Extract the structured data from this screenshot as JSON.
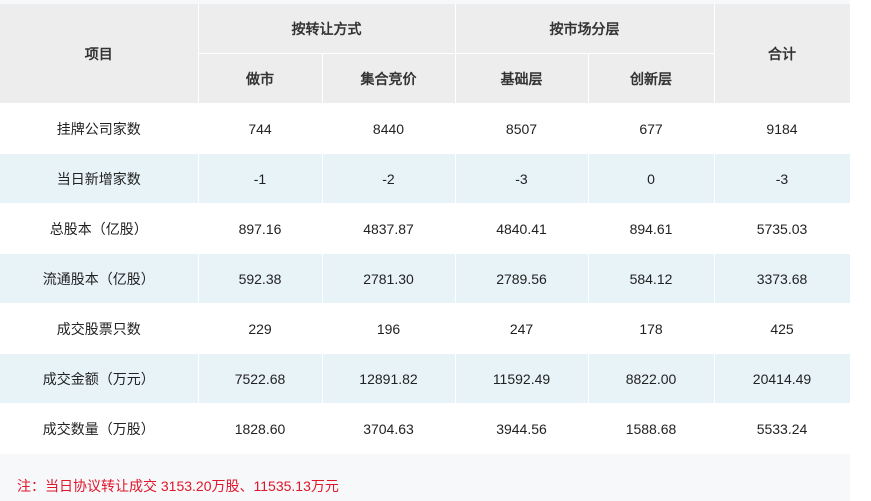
{
  "table": {
    "header": {
      "item": "项目",
      "group_transfer": "按转让方式",
      "group_market": "按市场分层",
      "total": "合计",
      "sub": [
        "做市",
        "集合竞价",
        "基础层",
        "创新层"
      ]
    },
    "rows": [
      {
        "label": "挂牌公司家数",
        "values": [
          "744",
          "8440",
          "8507",
          "677",
          "9184"
        ]
      },
      {
        "label": "当日新增家数",
        "values": [
          "-1",
          "-2",
          "-3",
          "0",
          "-3"
        ]
      },
      {
        "label": "总股本（亿股）",
        "values": [
          "897.16",
          "4837.87",
          "4840.41",
          "894.61",
          "5735.03"
        ]
      },
      {
        "label": "流通股本（亿股）",
        "values": [
          "592.38",
          "2781.30",
          "2789.56",
          "584.12",
          "3373.68"
        ]
      },
      {
        "label": "成交股票只数",
        "values": [
          "229",
          "196",
          "247",
          "178",
          "425"
        ]
      },
      {
        "label": "成交金额（万元）",
        "values": [
          "7522.68",
          "12891.82",
          "11592.49",
          "8822.00",
          "20414.49"
        ]
      },
      {
        "label": "成交数量（万股）",
        "values": [
          "1828.60",
          "3704.63",
          "3944.56",
          "1588.68",
          "5533.24"
        ]
      }
    ]
  },
  "note": "注：当日协议转让成交 3153.20万股、11535.13万元",
  "colors": {
    "header_bg": "#ededed",
    "row_alt_bg": "#e8f3f8",
    "note_color": "#e0162b"
  }
}
